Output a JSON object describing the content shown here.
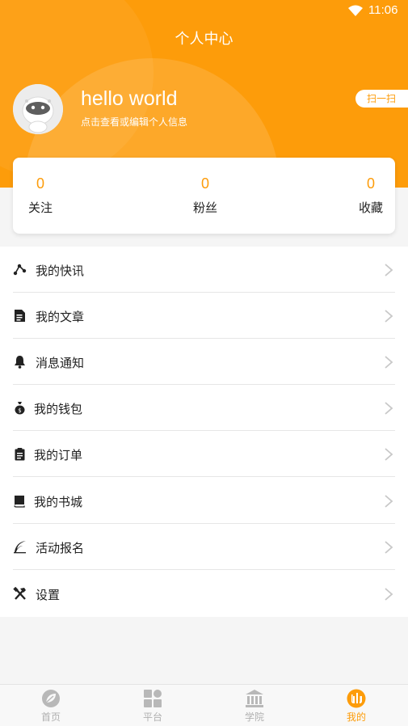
{
  "status_bar": {
    "time": "11:06",
    "wifi_icon": "wifi-icon"
  },
  "header": {
    "title": "个人中心",
    "background_color": "#fd9c0a"
  },
  "profile": {
    "avatar_icon": "astronaut-avatar",
    "username": "hello world",
    "hint": "点击查看或编辑个人信息",
    "scan_label": "扫一扫"
  },
  "stats": [
    {
      "value": "0",
      "label": "关注"
    },
    {
      "value": "0",
      "label": "粉丝"
    },
    {
      "value": "0",
      "label": "收藏"
    }
  ],
  "menu": [
    {
      "label": "我的快讯",
      "icon": "share-nodes-icon"
    },
    {
      "label": "我的文章",
      "icon": "document-icon"
    },
    {
      "label": "消息通知",
      "icon": "bell-icon"
    },
    {
      "label": "我的钱包",
      "icon": "money-bag-icon"
    },
    {
      "label": "我的订单",
      "icon": "clipboard-icon"
    },
    {
      "label": "我的书城",
      "icon": "book-icon"
    },
    {
      "label": "活动报名",
      "icon": "quill-icon"
    },
    {
      "label": "设置",
      "icon": "tools-icon"
    }
  ],
  "tabbar": {
    "active_color": "#fd9c0a",
    "inactive_color": "#b0b0b0",
    "tabs": [
      {
        "label": "首页",
        "icon": "home-leaf-icon"
      },
      {
        "label": "平台",
        "icon": "grid-icon"
      },
      {
        "label": "学院",
        "icon": "institution-icon"
      },
      {
        "label": "我的",
        "icon": "profile-icon",
        "active": true
      }
    ]
  }
}
